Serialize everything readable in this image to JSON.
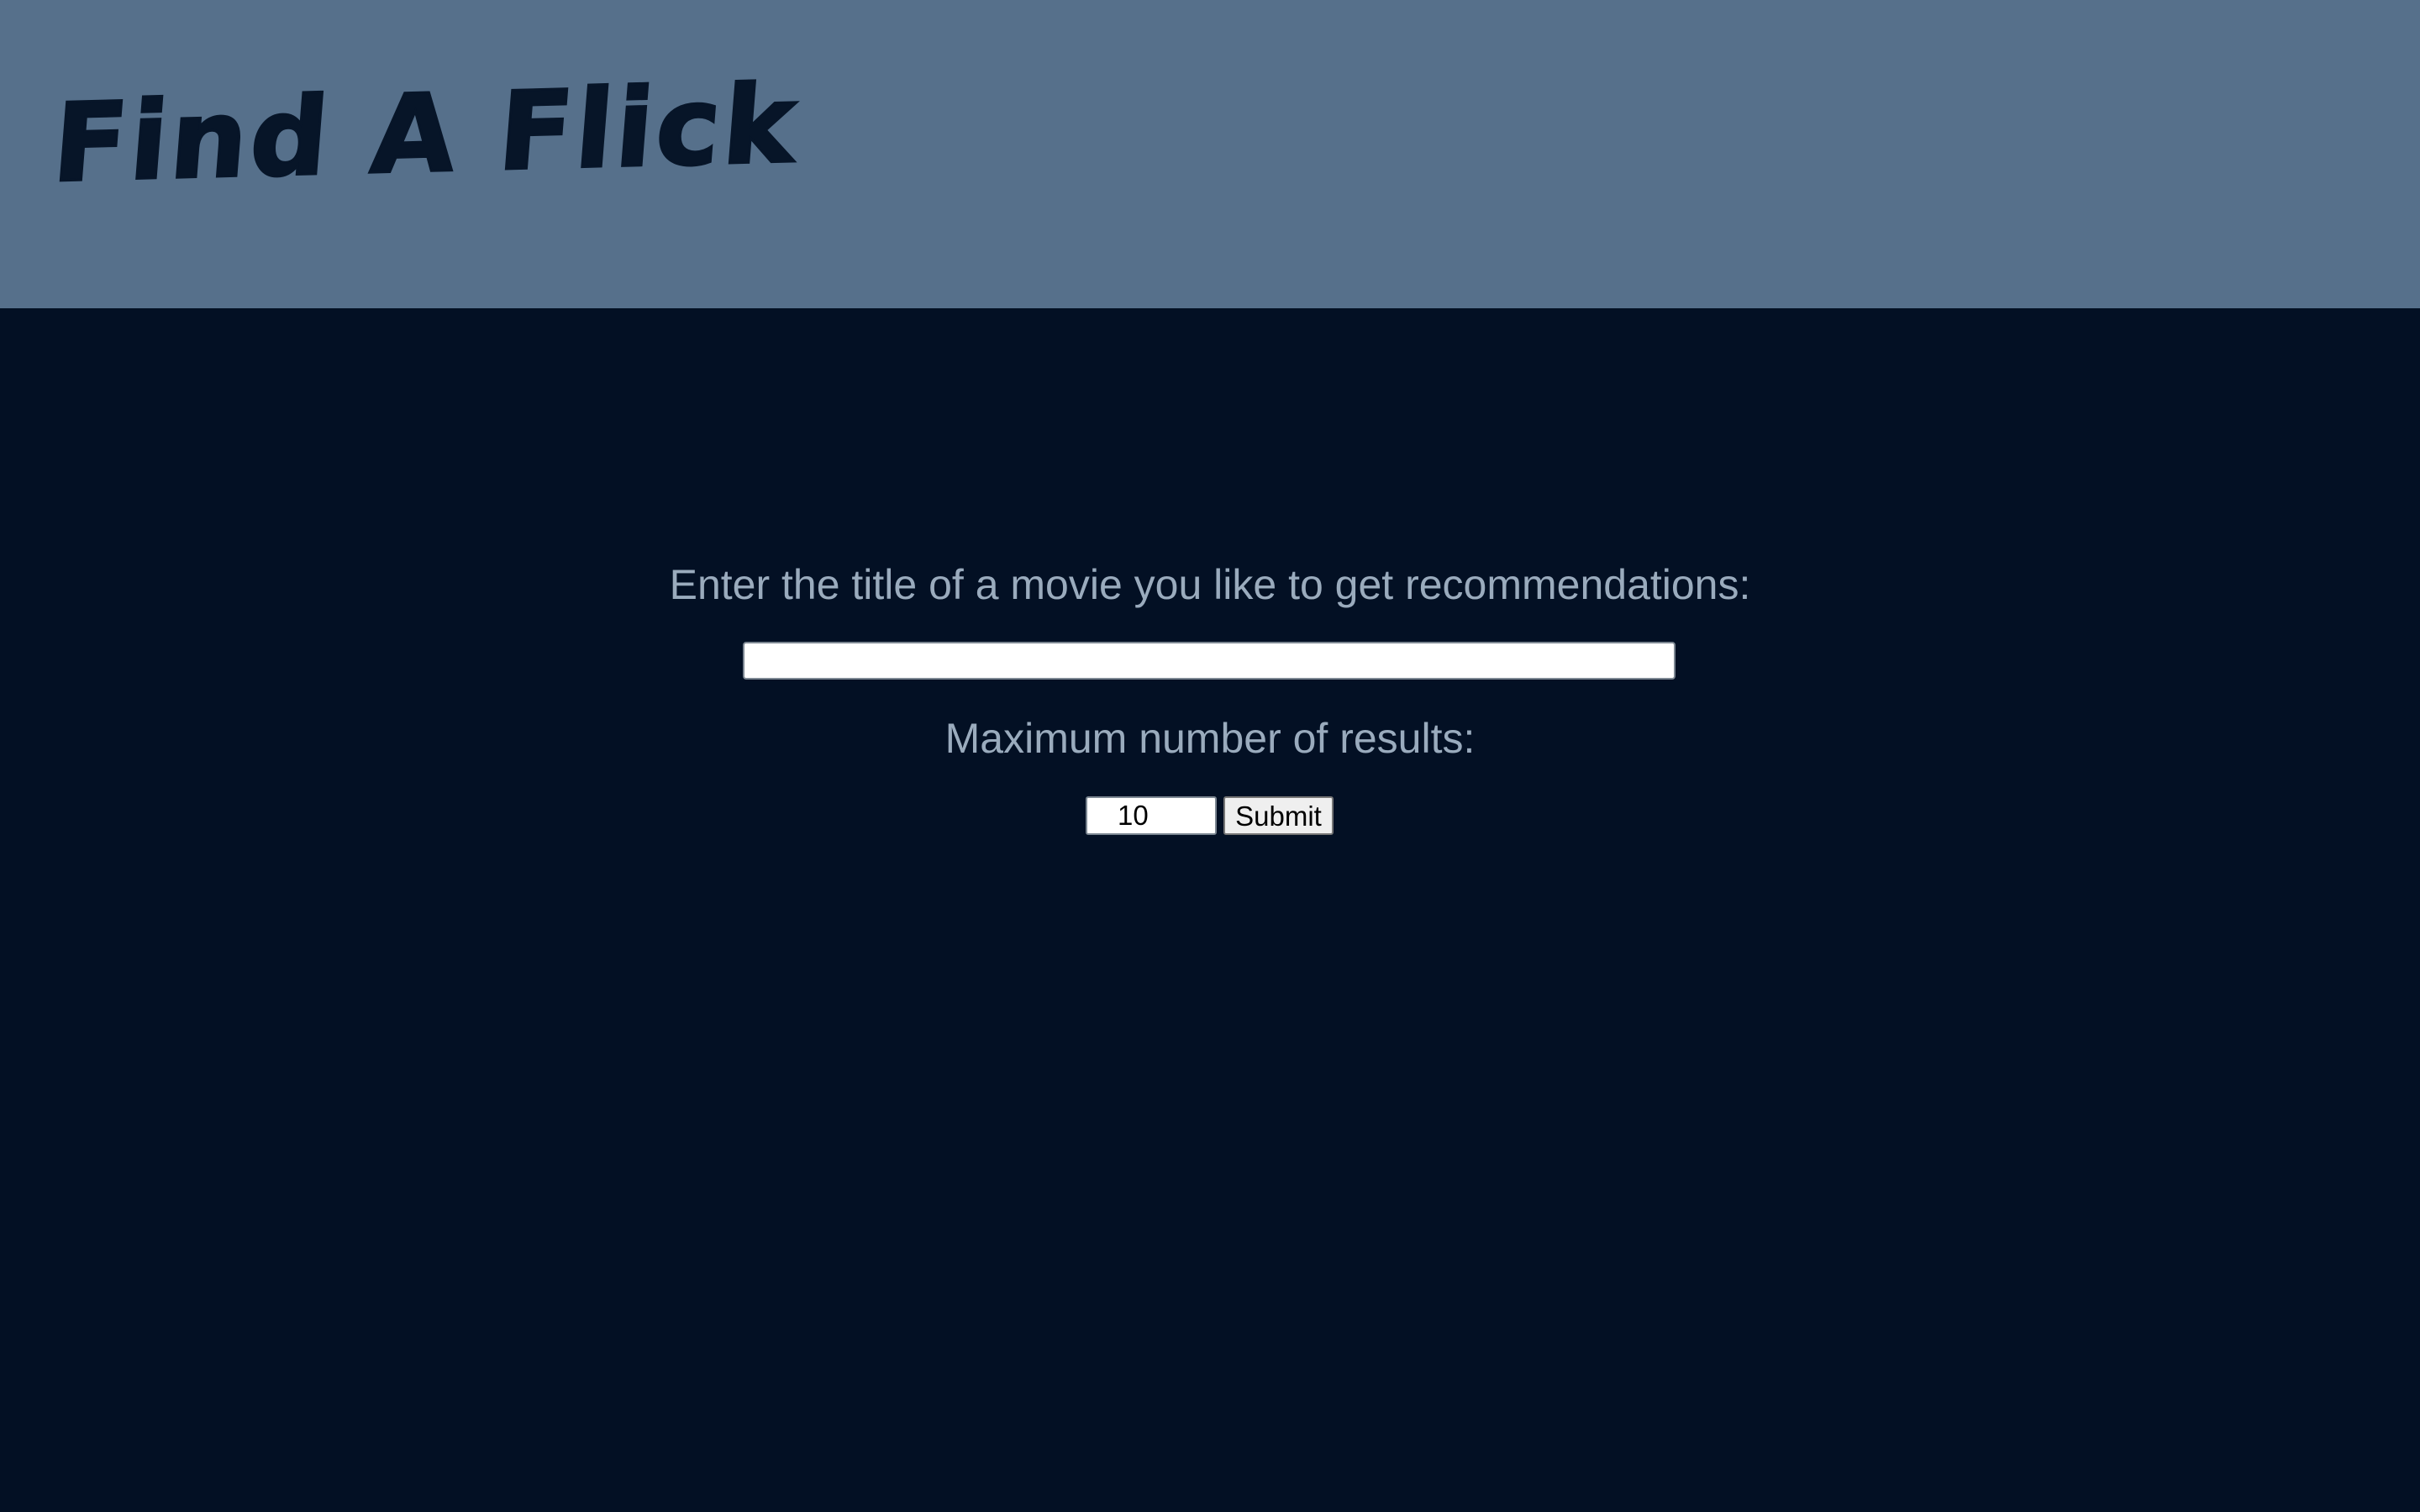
{
  "header": {
    "site_title": "Find A Flick"
  },
  "form": {
    "title_prompt": "Enter the title of a movie you like to get recommendations:",
    "title_input_value": "",
    "max_results_prompt": "Maximum number of results:",
    "max_results_value": "10",
    "submit_label": "Submit"
  },
  "colors": {
    "header_background": "#56708b",
    "page_background": "#031024",
    "label_text": "#9aabbd",
    "title_text": "#071528"
  }
}
